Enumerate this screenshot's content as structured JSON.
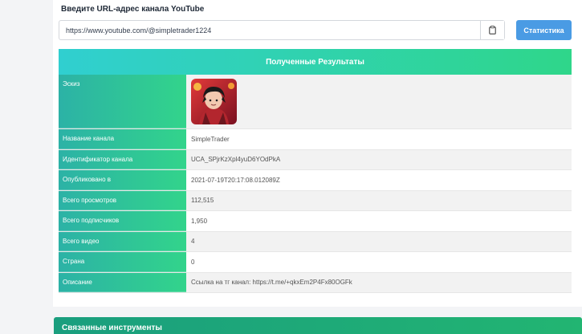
{
  "form": {
    "label": "Введите URL-адрес канала YouTube",
    "url_value": "https://www.youtube.com/@simpletrader1224",
    "submit_label": "Статистика",
    "clipboard_icon": "clipboard-icon"
  },
  "results": {
    "title": "Полученные Результаты",
    "thumbnail_label": "Эскиз",
    "rows": [
      {
        "label": "Название канала",
        "value": "SimpleTrader"
      },
      {
        "label": "Идентификатор канала",
        "value": "UCA_SPjrKzXpl4yuD6YOdPkA"
      },
      {
        "label": "Опубликовано в",
        "value": "2021-07-19T20:17:08.012089Z"
      },
      {
        "label": "Всего просмотров",
        "value": "112,515"
      },
      {
        "label": "Всего подписчиков",
        "value": "1,950"
      },
      {
        "label": "Всего видео",
        "value": "4"
      },
      {
        "label": "Страна",
        "value": "0"
      },
      {
        "label": "Описание",
        "value": "Ссылка на тг канал: https://t.me/+qkxEm2P4Fx80OGFk"
      }
    ]
  },
  "related": {
    "title": "Связанные инструменты"
  },
  "colors": {
    "accent_button": "#4a9be4",
    "header_gradient_start": "#30cfd0",
    "header_gradient_end": "#2fd68a"
  }
}
